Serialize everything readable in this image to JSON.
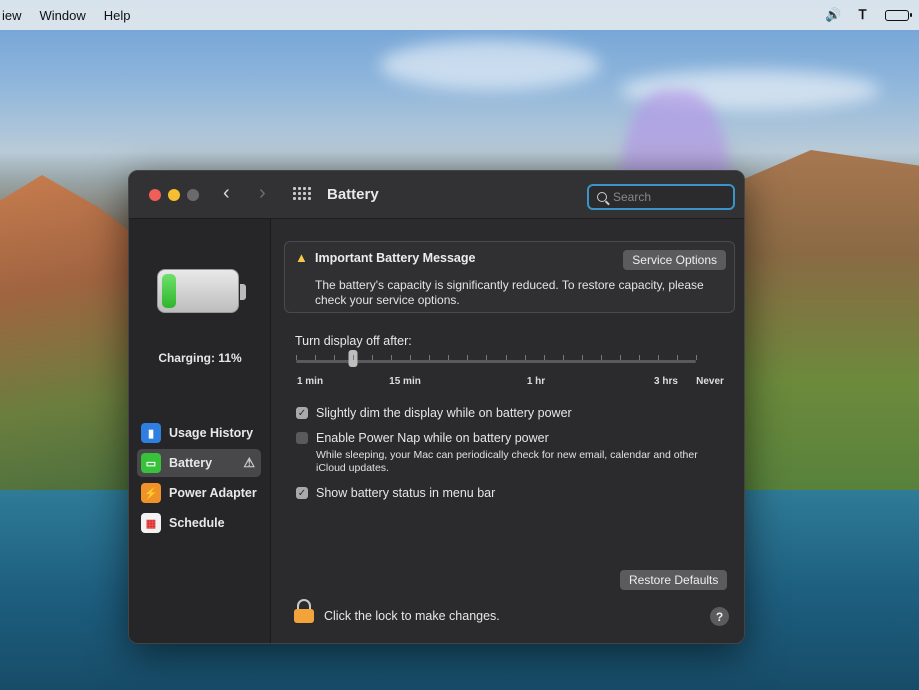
{
  "menubar": {
    "items": [
      "iew",
      "Window",
      "Help"
    ],
    "icons": [
      "volume-icon",
      "bluetooth-icon",
      "battery-charging-icon"
    ]
  },
  "window": {
    "title": "Battery",
    "search": {
      "placeholder": "Search",
      "value": ""
    }
  },
  "sidebar": {
    "battery_level_percent": 11,
    "charging_text": "Charging: 11%",
    "items": [
      {
        "label": "Usage History",
        "icon": "usage-history-icon",
        "selected": false
      },
      {
        "label": "Battery",
        "icon": "battery-icon",
        "selected": true,
        "warning": true
      },
      {
        "label": "Power Adapter",
        "icon": "power-adapter-icon",
        "selected": false
      },
      {
        "label": "Schedule",
        "icon": "schedule-icon",
        "selected": false
      }
    ]
  },
  "message": {
    "title": "Important Battery Message",
    "button": "Service Options",
    "body": "The battery's capacity is significantly reduced. To restore capacity, please check your service options."
  },
  "display_off": {
    "label": "Turn display off after:",
    "tick_labels": [
      "1 min",
      "15 min",
      "1 hr",
      "3 hrs",
      "Never"
    ],
    "current": "2 min",
    "ticks": 22
  },
  "options": [
    {
      "label": "Slightly dim the display while on battery power",
      "checked": true
    },
    {
      "label": "Enable Power Nap while on battery power",
      "checked": false,
      "note": "While sleeping, your Mac can periodically check for new email, calendar and other iCloud updates."
    },
    {
      "label": "Show battery status in menu bar",
      "checked": true
    }
  ],
  "footer": {
    "restore_button": "Restore Defaults",
    "lock_text": "Click the lock to make changes.",
    "help": "?"
  },
  "colors": {
    "accent_focus": "#3a94c9",
    "battery_green": "#38c23b",
    "warning_yellow": "#f5c84a",
    "lock_orange": "#f2a43a"
  }
}
